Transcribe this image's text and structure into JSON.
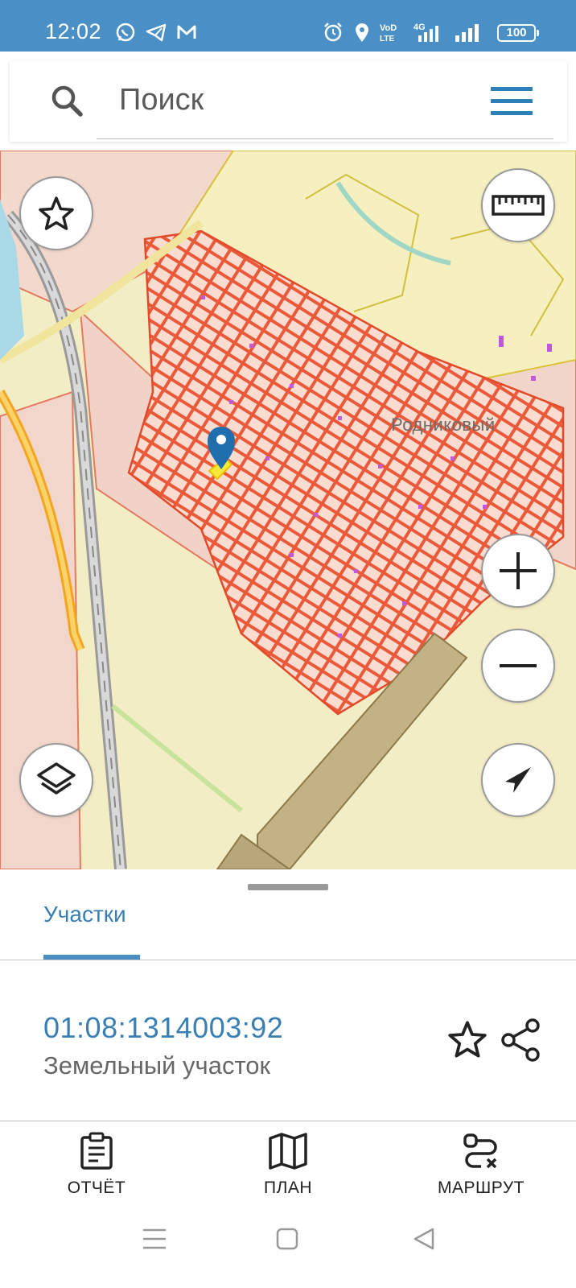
{
  "status_bar": {
    "time": "12:02",
    "battery": "100",
    "network_label": "4G"
  },
  "search": {
    "placeholder": "Поиск"
  },
  "map": {
    "place_label": "Родниковый"
  },
  "sheet": {
    "tab_label": "Участки",
    "parcel": {
      "number": "01:08:1314003:92",
      "type": "Земельный участок"
    },
    "actions": {
      "report": "ОТЧЁТ",
      "plan": "ПЛАН",
      "route": "МАРШРУТ"
    }
  },
  "colors": {
    "status_bar": "#4a90c6",
    "accent": "#3a7fb3",
    "parcel_outline": "#e85a3c",
    "map_background": "#f2ecd0",
    "marker": "#1f6fae"
  },
  "icons": [
    "search-icon",
    "menu-icon",
    "star-icon",
    "ruler-icon",
    "layers-icon",
    "zoom-in-icon",
    "zoom-out-icon",
    "locate-arrow-icon",
    "share-icon",
    "report-icon",
    "map-plan-icon",
    "route-icon"
  ]
}
